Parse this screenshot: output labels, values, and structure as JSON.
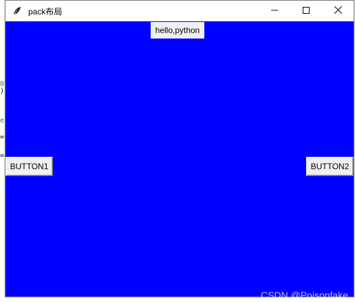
{
  "window": {
    "title": "pack布局",
    "minimize_label": "Minimize",
    "maximize_label": "Maximize",
    "close_label": "Close"
  },
  "app": {
    "label_text": "hello,python",
    "button_left": "BUTTON1",
    "button_right": "BUTTON2",
    "background_color": "#0000ff"
  },
  "icons": {
    "app": "feather-icon",
    "minimize": "minimize-icon",
    "maximize": "maximize-icon",
    "close": "close-icon"
  },
  "watermark": "CSDN @Poisonfake"
}
